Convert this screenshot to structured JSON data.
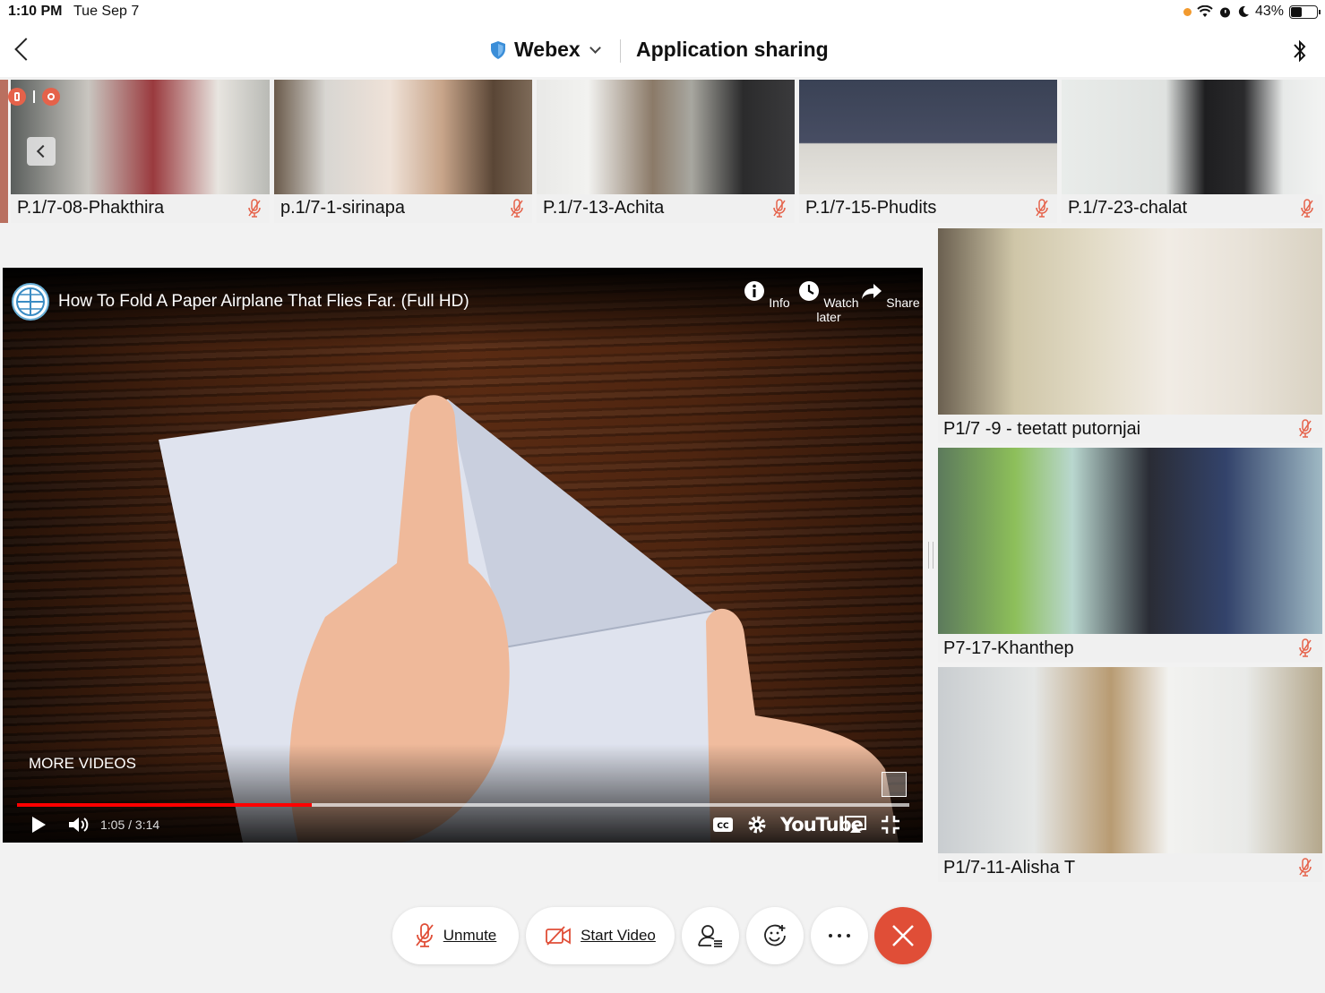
{
  "status_bar": {
    "time": "1:10 PM",
    "date": "Tue Sep 7",
    "battery": "43%"
  },
  "header": {
    "app_name": "Webex",
    "title": "Application sharing"
  },
  "thumbnails": [
    {
      "name": "P.1/7-08-Phakthira"
    },
    {
      "name": "p.1/7-1-sirinapa"
    },
    {
      "name": "P.1/7-13-Achita"
    },
    {
      "name": "P.1/7-15-Phudits"
    },
    {
      "name": "P.1/7-23-chalat"
    }
  ],
  "shared_video": {
    "title": "How To Fold A Paper Airplane That Flies Far. (Full HD)",
    "actions": [
      {
        "label": "Info",
        "icon": "info-icon"
      },
      {
        "label": "Watch later",
        "icon": "clock-icon"
      },
      {
        "label": "Share",
        "icon": "share-arrow-icon"
      }
    ],
    "more_videos": "MORE VIDEOS",
    "time_display": "1:05 / 3:14",
    "progress": 0.33,
    "brand": "YouTube"
  },
  "side_tiles": [
    {
      "name": "P1/7 -9 - teetatt putornjai"
    },
    {
      "name": "P7-17-Khanthep"
    },
    {
      "name": "P1/7-11-Alisha T"
    }
  ],
  "controls": {
    "unmute": "Unmute",
    "start_video": "Start Video",
    "leave_color": "#e04e37"
  }
}
